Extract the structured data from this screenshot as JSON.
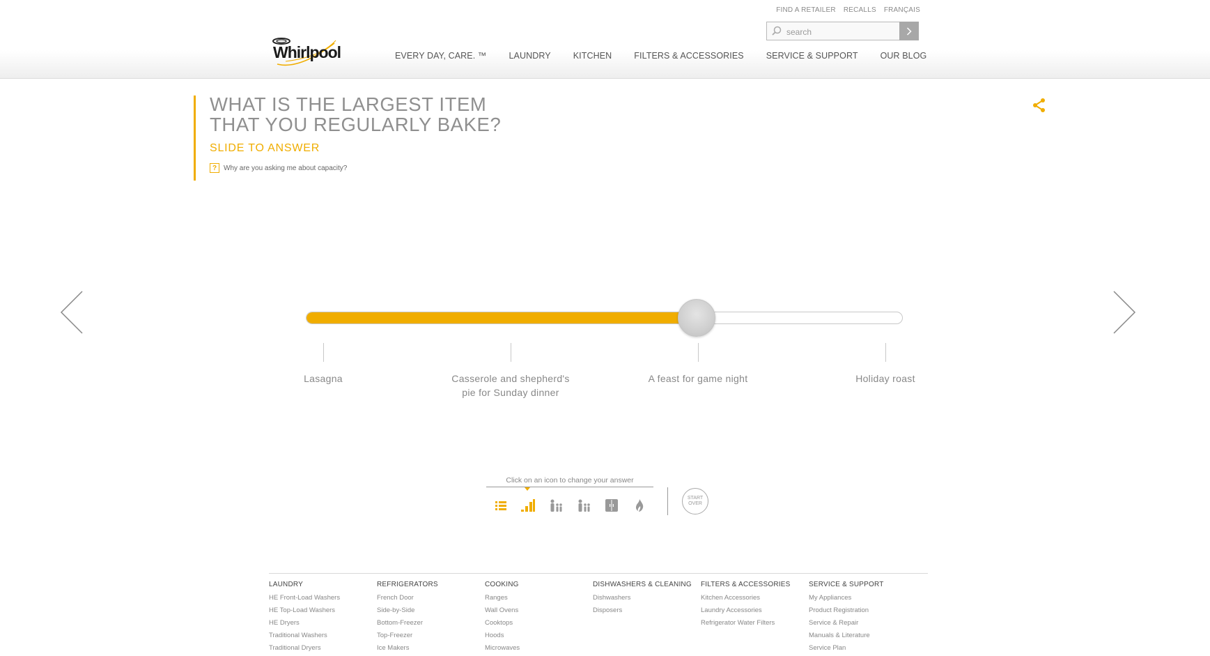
{
  "header": {
    "util_nav": [
      "FIND A RETAILER",
      "RECALLS",
      "FRANÇAIS"
    ],
    "search": {
      "placeholder": "search"
    },
    "logo_text": "Whirlpool",
    "main_nav": [
      "EVERY DAY, CARE. ™",
      "LAUNDRY",
      "KITCHEN",
      "FILTERS & ACCESSORIES",
      "SERVICE & SUPPORT",
      "OUR BLOG"
    ]
  },
  "question": {
    "title_line1": "WHAT IS THE LARGEST ITEM",
    "title_line2": "THAT YOU REGULARLY BAKE?",
    "subtitle": "SLIDE TO ANSWER",
    "help_link": "Why are you asking me about capacity?"
  },
  "slider": {
    "value_fraction": 0.655,
    "options": [
      "Lasagna",
      "Casserole and shepherd's pie for Sunday dinner",
      "A feast for game night",
      "Holiday roast"
    ],
    "accent_color": "#f0ad00"
  },
  "answer_nav": {
    "hint": "Click on an icon to change your answer",
    "icons": [
      "list-icon",
      "bar-level-icon",
      "family-icon",
      "family-icon",
      "fridge-icon",
      "flame-icon"
    ],
    "active_index": 1,
    "start_over": "START OVER"
  },
  "footer": {
    "columns": [
      {
        "heading": "LAUNDRY",
        "links": [
          "HE Front-Load Washers",
          "HE Top-Load Washers",
          "HE Dryers",
          "Traditional Washers",
          "Traditional Dryers"
        ]
      },
      {
        "heading": "REFRIGERATORS",
        "links": [
          "French Door",
          "Side-by-Side",
          "Bottom-Freezer",
          "Top-Freezer",
          "Ice Makers"
        ]
      },
      {
        "heading": "COOKING",
        "links": [
          "Ranges",
          "Wall Ovens",
          "Cooktops",
          "Hoods",
          "Microwaves"
        ]
      },
      {
        "heading": "DISHWASHERS & CLEANING",
        "links": [
          "Dishwashers",
          "Disposers"
        ]
      },
      {
        "heading": "FILTERS & ACCESSORIES",
        "links": [
          "Kitchen Accessories",
          "Laundry Accessories",
          "Refrigerator Water Filters"
        ]
      },
      {
        "heading": "SERVICE & SUPPORT",
        "links": [
          "My Appliances",
          "Product Registration",
          "Service & Repair",
          "Manuals & Literature",
          "Service Plan"
        ]
      }
    ]
  }
}
